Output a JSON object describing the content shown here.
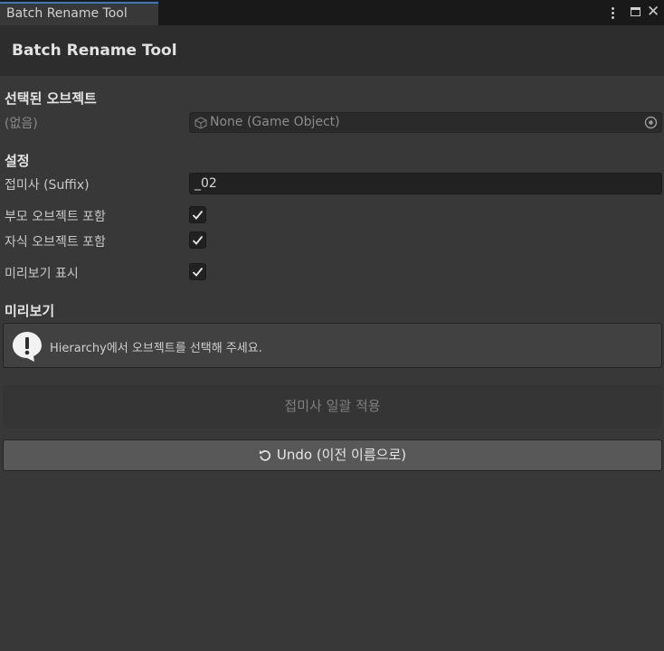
{
  "window": {
    "tab_title": "Batch Rename Tool",
    "header_title": "Batch Rename Tool"
  },
  "selected_object": {
    "section_title": "선택된 오브젝트",
    "label": "(없음)",
    "field_value": "None (Game Object)"
  },
  "settings": {
    "section_title": "설정",
    "suffix_label": "접미사 (Suffix)",
    "suffix_value": "_02",
    "include_parent_label": "부모 오브젝트 포함",
    "include_parent_checked": true,
    "include_children_label": "자식 오브젝트 포함",
    "include_children_checked": true,
    "show_preview_label": "미리보기 표시",
    "show_preview_checked": true
  },
  "preview": {
    "section_title": "미리보기",
    "help_message": "Hierarchy에서 오브젝트를 선택해 주세요."
  },
  "actions": {
    "apply_label": "접미사 일괄 적용",
    "undo_label": "Undo (이전 이름으로)"
  },
  "icons": {
    "tab_menu": "kebab-menu-icon",
    "maximize": "maximize-icon",
    "close": "close-icon",
    "object": "cube-icon",
    "object_picker": "object-picker-icon",
    "checkmark": "checkmark-icon",
    "info": "warning-bubble-icon",
    "undo": "undo-icon"
  },
  "colors": {
    "background": "#383838",
    "header": "#2d2d2d",
    "tab_accent": "#3a79bb",
    "button": "#585858"
  }
}
